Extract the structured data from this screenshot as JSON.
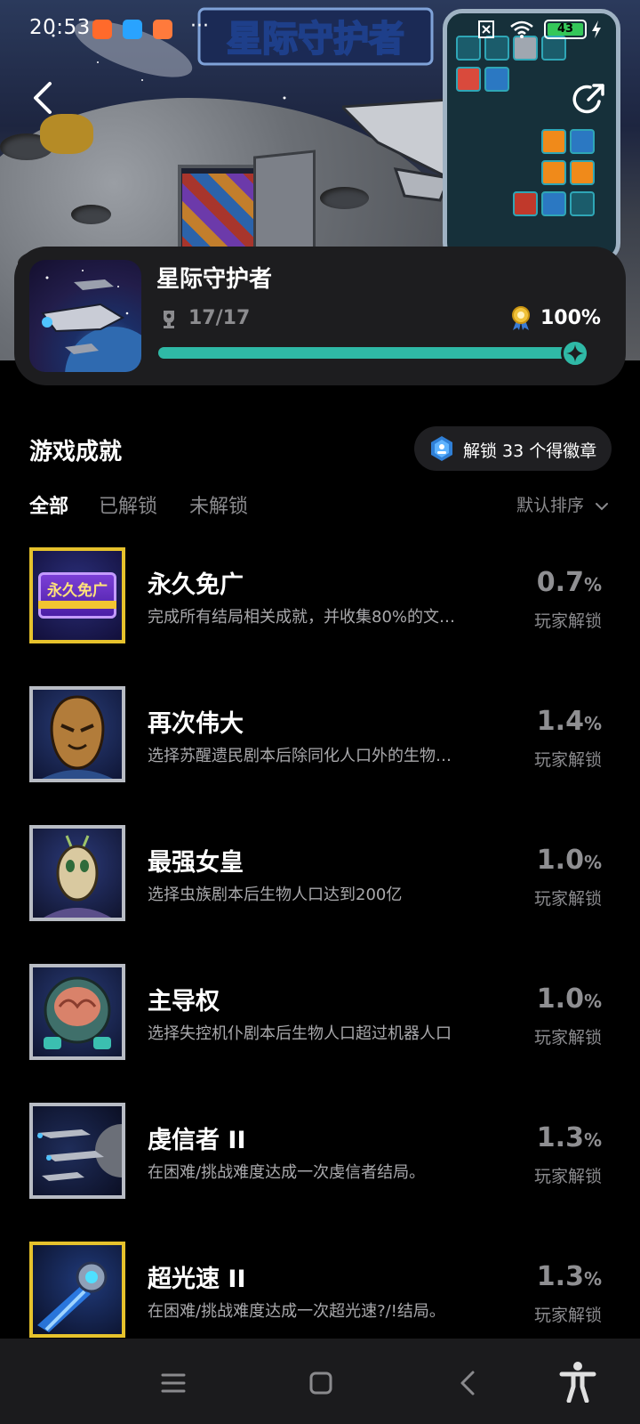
{
  "status_bar": {
    "time": "20:53",
    "more": "···",
    "battery": "43"
  },
  "hero": {
    "logo_text": "星际守护者"
  },
  "game": {
    "title": "星际守护者",
    "trophies": "17/17",
    "completion": "100%",
    "progress_fraction": 1.0
  },
  "section": {
    "title": "游戏成就",
    "badge_text": "解锁 33 个得徽章"
  },
  "tabs": [
    "全部",
    "已解锁",
    "未解锁"
  ],
  "sort_label": "默认排序",
  "achievements": [
    {
      "title": "永久免广",
      "desc": "完成所有结局相关成就，并收集80%的文…",
      "rate": "0.7",
      "pct": "%",
      "rate_label": "玩家解锁",
      "thumb_text": "永久免广",
      "frame": "gold"
    },
    {
      "title": "再次伟大",
      "desc": "选择苏醒遗民剧本后除同化人口外的生物…",
      "rate": "1.4",
      "pct": "%",
      "rate_label": "玩家解锁",
      "frame": "silver"
    },
    {
      "title": "最强女皇",
      "desc": "选择虫族剧本后生物人口达到200亿",
      "rate": "1.0",
      "pct": "%",
      "rate_label": "玩家解锁",
      "frame": "silver"
    },
    {
      "title": "主导权",
      "desc": "选择失控机仆剧本后生物人口超过机器人口",
      "rate": "1.0",
      "pct": "%",
      "rate_label": "玩家解锁",
      "frame": "silver"
    },
    {
      "title": "虔信者 II",
      "desc": "在困难/挑战难度达成一次虔信者结局。",
      "rate": "1.3",
      "pct": "%",
      "rate_label": "玩家解锁",
      "frame": "silver"
    },
    {
      "title": "超光速 II",
      "desc": "在困难/挑战难度达成一次超光速?/!结局。",
      "rate": "1.3",
      "pct": "%",
      "rate_label": "玩家解锁",
      "frame": "gold"
    }
  ],
  "colors": {
    "accent": "#2fb9a6",
    "gold_frame": "#e6c22c",
    "silver_frame": "#b8bcc4",
    "card_bg": "#1d1d1f"
  },
  "icons": {
    "back": "chevron-left-icon",
    "share": "share-icon",
    "trophy": "trophy-icon",
    "medal": "medal-icon",
    "badge": "badge-icon",
    "sort": "chevron-down-icon",
    "nav_menu": "menu-icon",
    "nav_home": "home-icon",
    "nav_back": "back-icon",
    "nav_accessibility": "accessibility-icon"
  }
}
